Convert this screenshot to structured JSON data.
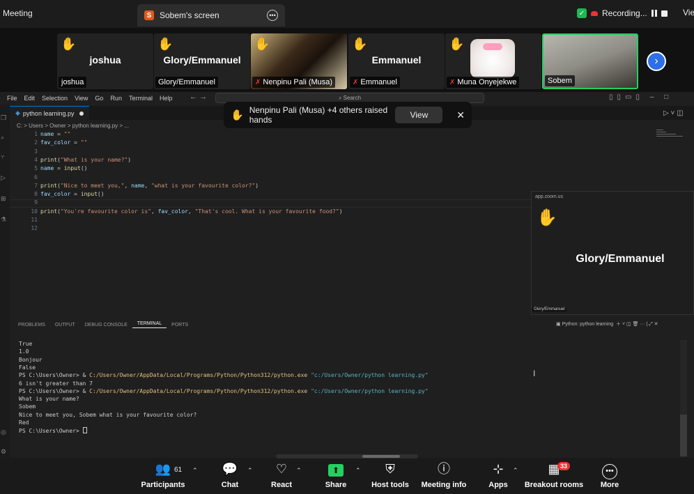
{
  "zoom_top": {
    "meeting_label": "Meeting",
    "share_badge": "S",
    "share_tab_title": "Sobem's screen",
    "recording_label": "Recording...",
    "view_label": "Vie"
  },
  "participants_strip": [
    {
      "name": "joshua",
      "big": "joshua",
      "hand": true,
      "muted": false
    },
    {
      "name": "Glory/Emmanuel",
      "big": "Glory/Emmanuel",
      "hand": true,
      "muted": false
    },
    {
      "name": "Nenpinu Pali (Musa)",
      "big": "",
      "hand": true,
      "muted": true
    },
    {
      "name": "Emmanuel",
      "big": "Emmanuel",
      "hand": true,
      "muted": true
    },
    {
      "name": "Muna Onyejekwe",
      "big": "",
      "hand": true,
      "muted": true
    },
    {
      "name": "Sobem",
      "big": "",
      "hand": false,
      "muted": false
    }
  ],
  "vscode": {
    "menu": [
      "File",
      "Edit",
      "Selection",
      "View",
      "Go",
      "Run",
      "Terminal",
      "Help"
    ],
    "search_placeholder": "Search",
    "tab_filename": "python learning.py",
    "breadcrumb": "C: > Users > Owner > python learning.py > ...",
    "code_lines": [
      {
        "n": "1",
        "parts": [
          [
            "var",
            "name"
          ],
          [
            "pun",
            " = "
          ],
          [
            "str",
            "\"\""
          ]
        ]
      },
      {
        "n": "2",
        "parts": [
          [
            "var",
            "fav_color"
          ],
          [
            "pun",
            " = "
          ],
          [
            "str",
            "\"\""
          ]
        ]
      },
      {
        "n": "3",
        "parts": []
      },
      {
        "n": "4",
        "parts": [
          [
            "kw",
            "print"
          ],
          [
            "pun",
            "("
          ],
          [
            "str",
            "\"What is your name?\""
          ],
          [
            "pun",
            ")"
          ]
        ]
      },
      {
        "n": "5",
        "parts": [
          [
            "var",
            "name"
          ],
          [
            "pun",
            " = "
          ],
          [
            "kw",
            "input"
          ],
          [
            "pun",
            "()"
          ]
        ]
      },
      {
        "n": "6",
        "parts": []
      },
      {
        "n": "7",
        "parts": [
          [
            "kw",
            "print"
          ],
          [
            "pun",
            "("
          ],
          [
            "str",
            "\"Nice to meet you,\""
          ],
          [
            "pun",
            ", "
          ],
          [
            "var",
            "name"
          ],
          [
            "pun",
            ", "
          ],
          [
            "str",
            "\"what is your favourite color?\""
          ],
          [
            "pun",
            ")"
          ]
        ]
      },
      {
        "n": "8",
        "parts": [
          [
            "var",
            "fav_color"
          ],
          [
            "pun",
            " = "
          ],
          [
            "kw",
            "input"
          ],
          [
            "pun",
            "()"
          ]
        ]
      },
      {
        "n": "9",
        "parts": []
      },
      {
        "n": "10",
        "parts": [
          [
            "kw",
            "print"
          ],
          [
            "pun",
            "("
          ],
          [
            "str",
            "\"You're favourite color is\""
          ],
          [
            "pun",
            ", "
          ],
          [
            "var",
            "fav_color"
          ],
          [
            "pun",
            ", "
          ],
          [
            "str",
            "\"That's cool. What is your favourite food?\""
          ],
          [
            "pun",
            ")"
          ]
        ]
      },
      {
        "n": "11",
        "parts": []
      },
      {
        "n": "12",
        "parts": []
      }
    ],
    "panel_tabs": [
      "PROBLEMS",
      "OUTPUT",
      "DEBUG CONSOLE",
      "TERMINAL",
      "PORTS"
    ],
    "active_panel_tab": "TERMINAL",
    "terminal_profile": "Python: python learning",
    "terminal_lines": [
      [
        [
          "pun",
          "True"
        ]
      ],
      [
        [
          "pun",
          "1.0"
        ]
      ],
      [
        [
          "pun",
          "Bonjour"
        ]
      ],
      [
        [
          "pun",
          "False"
        ]
      ],
      [
        [
          "pun",
          "PS C:\\Users\\Owner> & "
        ],
        [
          "yel",
          "C:/Users/Owner/AppData/Local/Programs/Python/Python312/python.exe"
        ],
        [
          "pun",
          " "
        ],
        [
          "cy",
          "\"c:/Users/Owner/python learning.py\""
        ]
      ],
      [
        [
          "pun",
          "6 isn't greater than 7"
        ]
      ],
      [
        [
          "pun",
          "PS C:\\Users\\Owner> & "
        ],
        [
          "yel",
          "C:/Users/Owner/AppData/Local/Programs/Python/Python312/python.exe"
        ],
        [
          "pun",
          " "
        ],
        [
          "cy",
          "\"c:/Users/Owner/python learning.py\""
        ]
      ],
      [
        [
          "pun",
          "What is your name?"
        ]
      ],
      [
        [
          "pun",
          "Sobem"
        ]
      ],
      [
        [
          "pun",
          "Nice to meet you, Sobem what is your favourite color?"
        ]
      ],
      [
        [
          "pun",
          "Red"
        ]
      ],
      [
        [
          "pun",
          "PS C:\\Users\\Owner> "
        ]
      ]
    ]
  },
  "toast": {
    "text": "Nenpinu Pali (Musa) +4 others raised hands",
    "view_button": "View"
  },
  "float_panel": {
    "title": "app.zoom.us",
    "name": "Glory/Emmanuel",
    "label": "Glory/Emmanuel"
  },
  "bottom_bar": {
    "participants_label": "Participants",
    "participants_count": "61",
    "chat_label": "Chat",
    "react_label": "React",
    "share_label": "Share",
    "host_tools_label": "Host tools",
    "meeting_info_label": "Meeting info",
    "apps_label": "Apps",
    "breakout_label": "Breakout rooms",
    "breakout_badge": "33",
    "more_label": "More"
  }
}
